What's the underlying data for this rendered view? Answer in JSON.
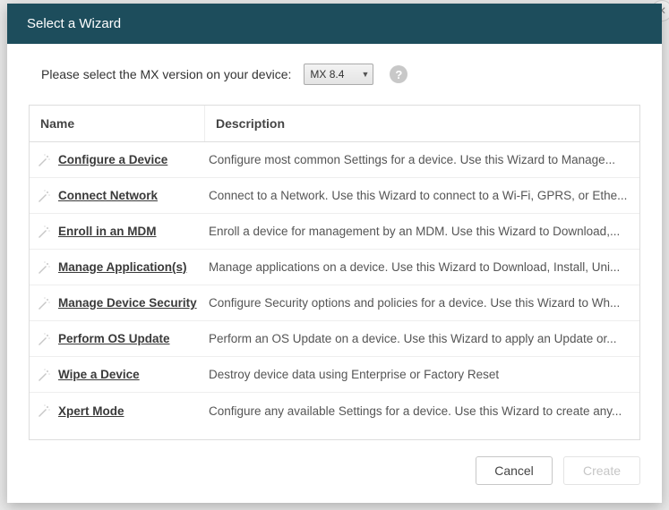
{
  "title": "Select a Wizard",
  "prompt": "Please select the MX version on your device:",
  "mx_select": {
    "value": "MX 8.4"
  },
  "columns": {
    "name": "Name",
    "description": "Description"
  },
  "wizards": [
    {
      "name": "Configure a Device",
      "desc": "Configure most common Settings for a device. Use this Wizard to Manage..."
    },
    {
      "name": "Connect Network",
      "desc": "Connect to a Network. Use this Wizard to connect to a Wi-Fi, GPRS, or Ethe..."
    },
    {
      "name": "Enroll in an MDM",
      "desc": "Enroll a device for management by an MDM.  Use this Wizard to Download,..."
    },
    {
      "name": "Manage Application(s)",
      "desc": "Manage applications on a device.  Use this Wizard to Download, Install, Uni..."
    },
    {
      "name": "Manage Device Security",
      "desc": "Configure Security options and policies for a device.  Use this Wizard to Wh..."
    },
    {
      "name": "Perform OS Update",
      "desc": "Perform an OS Update on a device.  Use this Wizard to apply an Update or..."
    },
    {
      "name": "Wipe a Device",
      "desc": "Destroy device data using Enterprise or Factory Reset"
    },
    {
      "name": "Xpert Mode",
      "desc": "Configure any available Settings for a device. Use this Wizard to create any..."
    }
  ],
  "buttons": {
    "cancel": "Cancel",
    "create": "Create"
  }
}
